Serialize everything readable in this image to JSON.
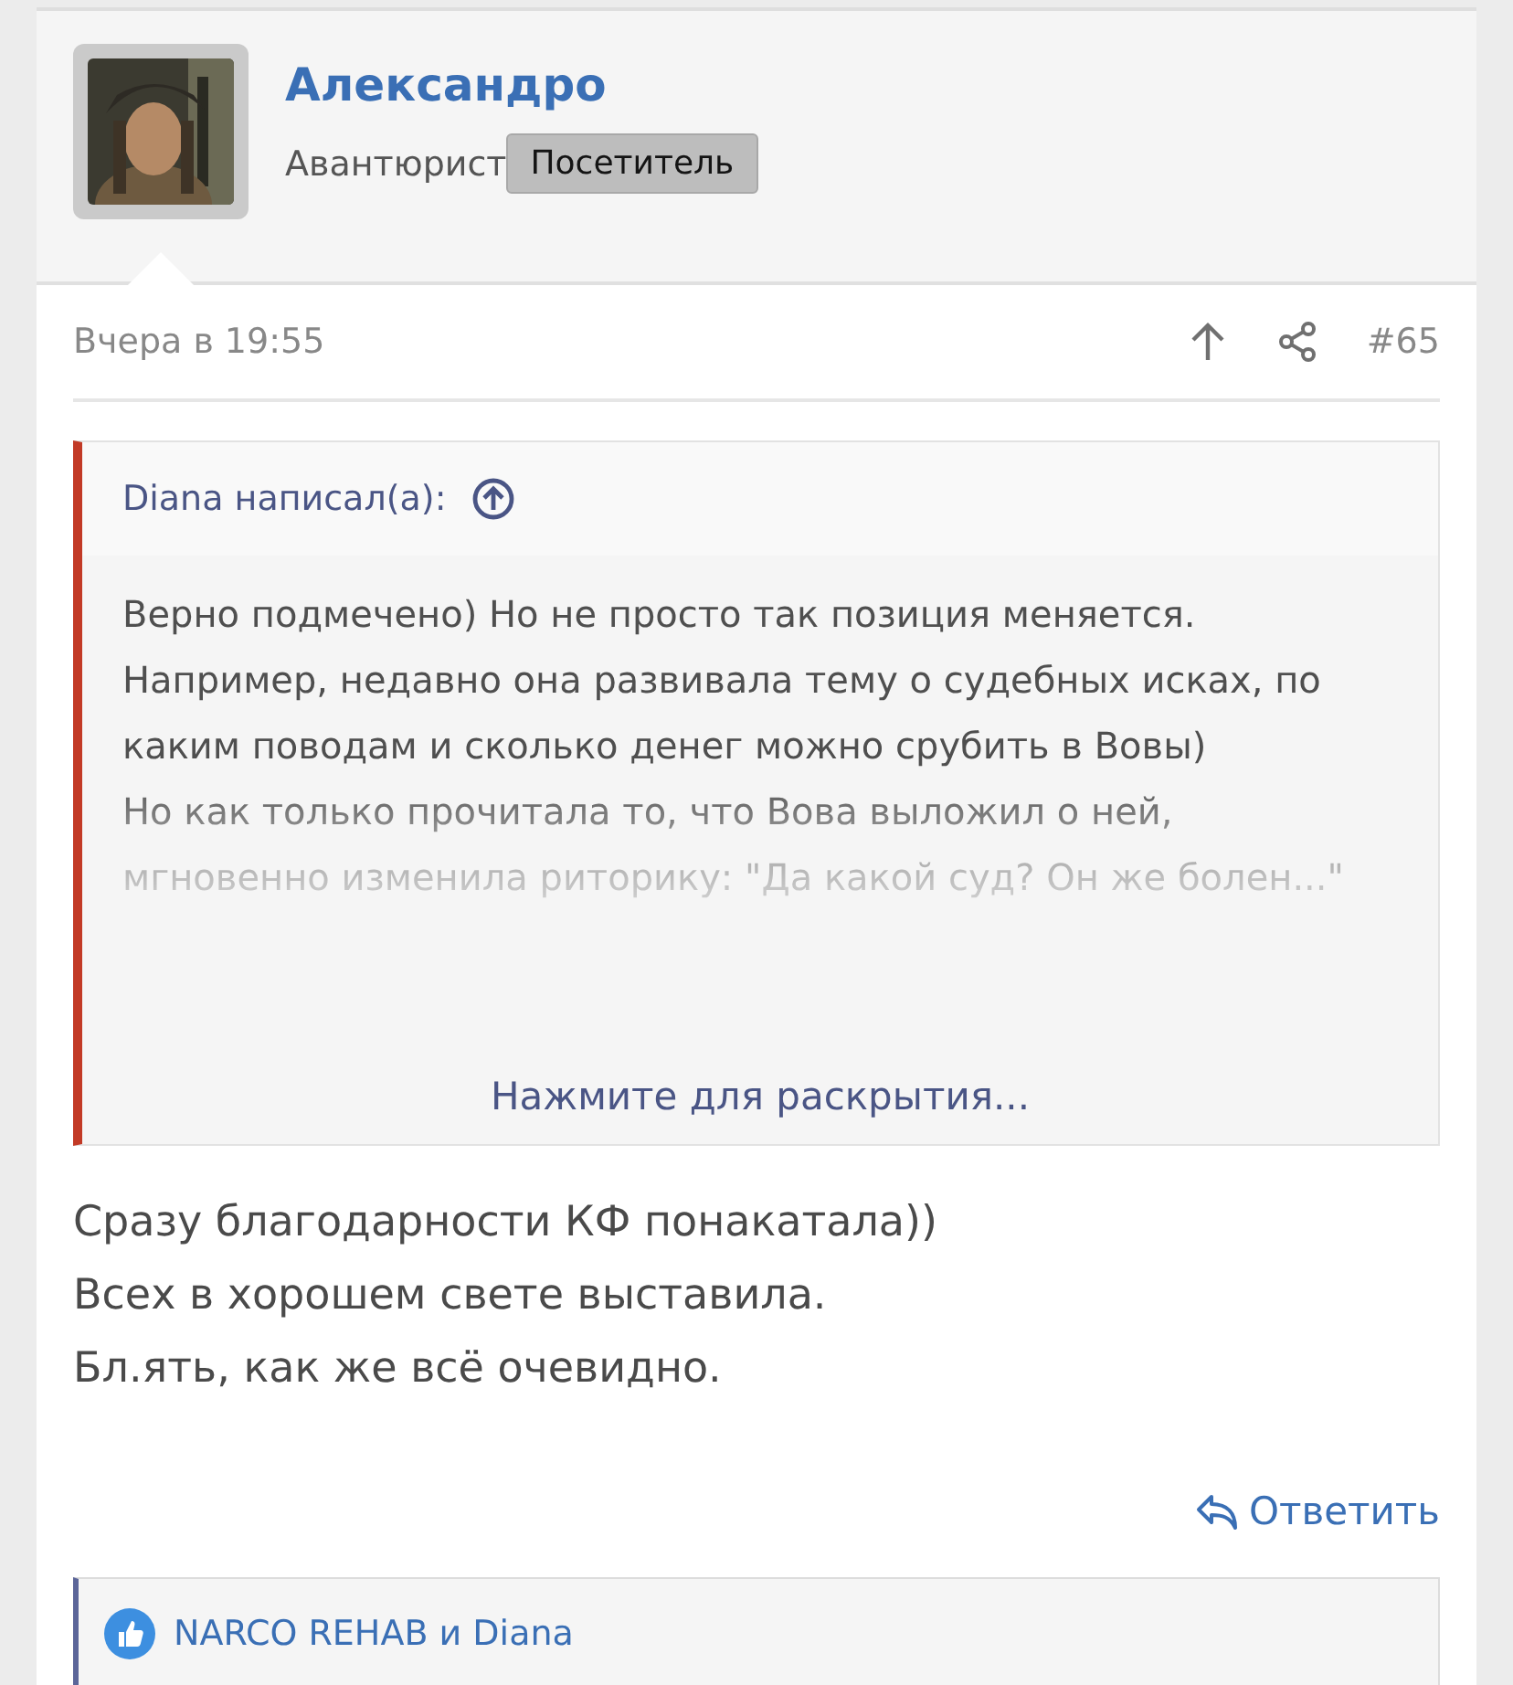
{
  "author": {
    "name": "Александро",
    "title": "Авантюрист",
    "badge": "Посетитель"
  },
  "post_meta": {
    "date": "Вчера в 19:55",
    "number": "#65"
  },
  "quote": {
    "header": "Diana написал(а):",
    "paragraphs": [
      "Верно подмечено) Но не просто так позиция меняется.",
      "Например, недавно она развивала тему о судебных исках, по каким поводам и сколько денег можно срубить в Вовы)",
      "Но как только прочитала то, что Вова выложил о ней, мгновенно изменила риторику: \"Да какой суд? Он же болен...\""
    ],
    "expand_link": "Нажмите для раскрытия..."
  },
  "body_lines": [
    "Сразу благодарности КФ понакатала))",
    "Всех в хорошем свете выставила.",
    "Бл.ять, как же всё очевидно."
  ],
  "reply_link": "Ответить",
  "reactions": "NARCO REHAB и Diana"
}
